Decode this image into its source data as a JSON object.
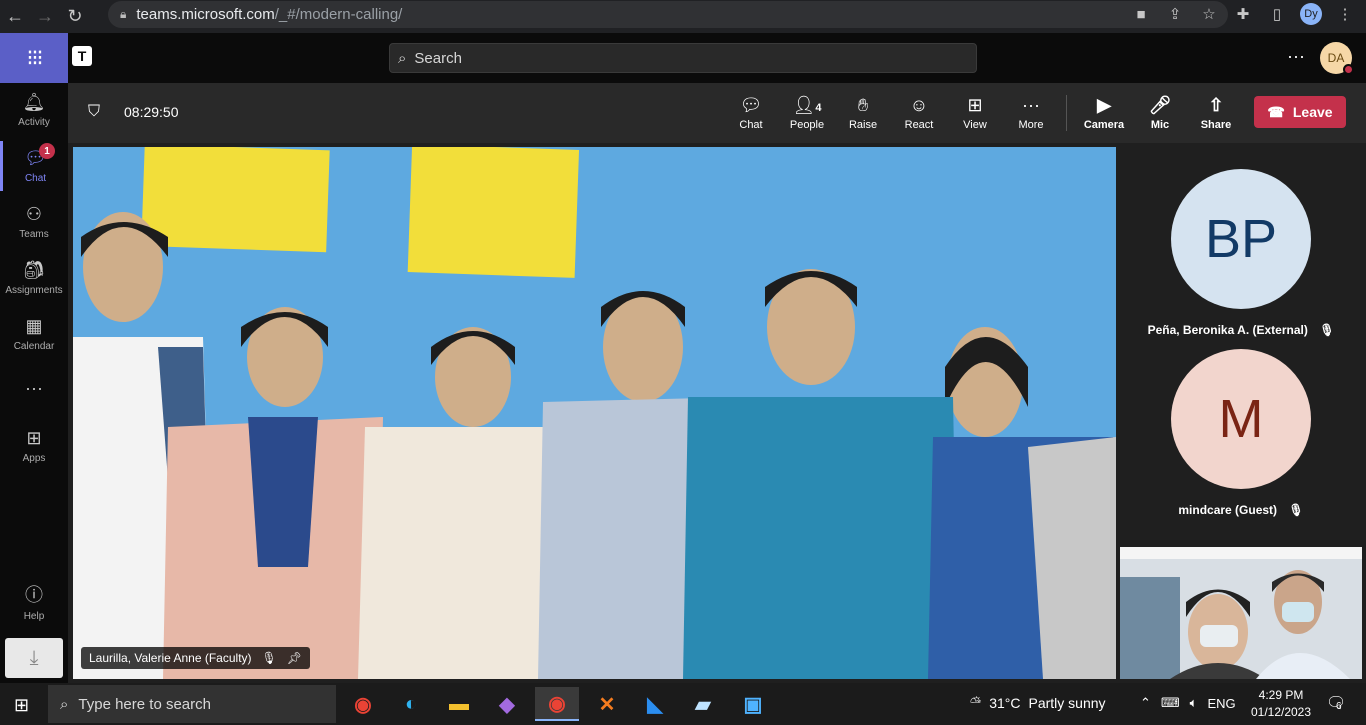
{
  "browser": {
    "url_domain": "teams.microsoft.com",
    "url_path": "/_#/modern-calling/",
    "profile": "Dy"
  },
  "teams": {
    "search_placeholder": "Search",
    "user_initials": "DA"
  },
  "rail": {
    "items": [
      {
        "label": "Activity",
        "icon": "bell-icon"
      },
      {
        "label": "Chat",
        "icon": "chat-icon",
        "badge": "1"
      },
      {
        "label": "Teams",
        "icon": "teams-icon"
      },
      {
        "label": "Assignments",
        "icon": "assignments-icon"
      },
      {
        "label": "Calendar",
        "icon": "calendar-icon"
      },
      {
        "label": "Apps",
        "icon": "apps-icon"
      },
      {
        "label": "Help",
        "icon": "help-icon"
      }
    ]
  },
  "meeting": {
    "timer": "08:29:50",
    "people_count": "4",
    "controls": {
      "chat": "Chat",
      "people": "People",
      "raise": "Raise",
      "react": "React",
      "view": "View",
      "more": "More",
      "camera": "Camera",
      "mic": "Mic",
      "share": "Share",
      "leave": "Leave"
    },
    "main_speaker": "Laurilla, Valerie Anne (Faculty)",
    "participants": [
      {
        "initials": "BP",
        "name": "Peña, Beronika A. (External)",
        "bg": "#d5e3f0",
        "fg": "#123a66"
      },
      {
        "initials": "M",
        "name": "mindcare (Guest)",
        "bg": "#f2d5cd",
        "fg": "#7a2414"
      }
    ]
  },
  "taskbar": {
    "search_placeholder": "Type here to search",
    "weather_temp": "31°C",
    "weather_desc": "Partly sunny",
    "language": "ENG",
    "time": "4:29 PM",
    "date": "01/12/2023",
    "notification_count": "6"
  },
  "colors": {
    "accent": "#5b5fc7",
    "leave": "#c4314b",
    "video_wall": "#5fa8df"
  }
}
